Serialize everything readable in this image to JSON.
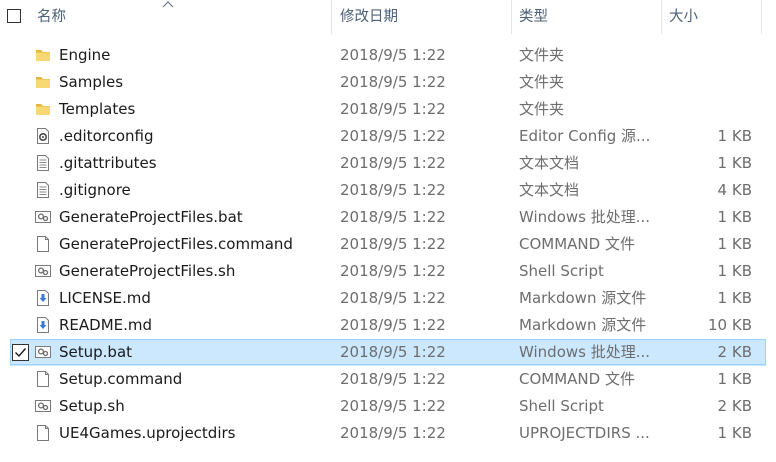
{
  "header": {
    "name": "名称",
    "date": "修改日期",
    "type": "类型",
    "size": "大小"
  },
  "rows": [
    {
      "name": "Engine",
      "date": "2018/9/5 1:22",
      "type": "文件夹",
      "size": "",
      "icon": "folder-icon",
      "selected": false
    },
    {
      "name": "Samples",
      "date": "2018/9/5 1:22",
      "type": "文件夹",
      "size": "",
      "icon": "folder-icon",
      "selected": false
    },
    {
      "name": "Templates",
      "date": "2018/9/5 1:22",
      "type": "文件夹",
      "size": "",
      "icon": "folder-icon",
      "selected": false
    },
    {
      "name": ".editorconfig",
      "date": "2018/9/5 1:22",
      "type": "Editor Config 源...",
      "size": "1 KB",
      "icon": "config-file-icon",
      "selected": false
    },
    {
      "name": ".gitattributes",
      "date": "2018/9/5 1:22",
      "type": "文本文档",
      "size": "1 KB",
      "icon": "text-file-icon",
      "selected": false
    },
    {
      "name": ".gitignore",
      "date": "2018/9/5 1:22",
      "type": "文本文档",
      "size": "4 KB",
      "icon": "text-file-icon",
      "selected": false
    },
    {
      "name": "GenerateProjectFiles.bat",
      "date": "2018/9/5 1:22",
      "type": "Windows 批处理...",
      "size": "1 KB",
      "icon": "script-file-icon",
      "selected": false
    },
    {
      "name": "GenerateProjectFiles.command",
      "date": "2018/9/5 1:22",
      "type": "COMMAND 文件",
      "size": "1 KB",
      "icon": "blank-file-icon",
      "selected": false
    },
    {
      "name": "GenerateProjectFiles.sh",
      "date": "2018/9/5 1:22",
      "type": "Shell Script",
      "size": "1 KB",
      "icon": "script-file-icon",
      "selected": false
    },
    {
      "name": "LICENSE.md",
      "date": "2018/9/5 1:22",
      "type": "Markdown 源文件",
      "size": "1 KB",
      "icon": "markdown-file-icon",
      "selected": false
    },
    {
      "name": "README.md",
      "date": "2018/9/5 1:22",
      "type": "Markdown 源文件",
      "size": "10 KB",
      "icon": "markdown-file-icon",
      "selected": false
    },
    {
      "name": "Setup.bat",
      "date": "2018/9/5 1:22",
      "type": "Windows 批处理...",
      "size": "2 KB",
      "icon": "script-file-icon",
      "selected": true
    },
    {
      "name": "Setup.command",
      "date": "2018/9/5 1:22",
      "type": "COMMAND 文件",
      "size": "1 KB",
      "icon": "blank-file-icon",
      "selected": false
    },
    {
      "name": "Setup.sh",
      "date": "2018/9/5 1:22",
      "type": "Shell Script",
      "size": "2 KB",
      "icon": "script-file-icon",
      "selected": false
    },
    {
      "name": "UE4Games.uprojectdirs",
      "date": "2018/9/5 1:22",
      "type": "UPROJECTDIRS ...",
      "size": "1 KB",
      "icon": "blank-file-icon",
      "selected": false
    }
  ]
}
